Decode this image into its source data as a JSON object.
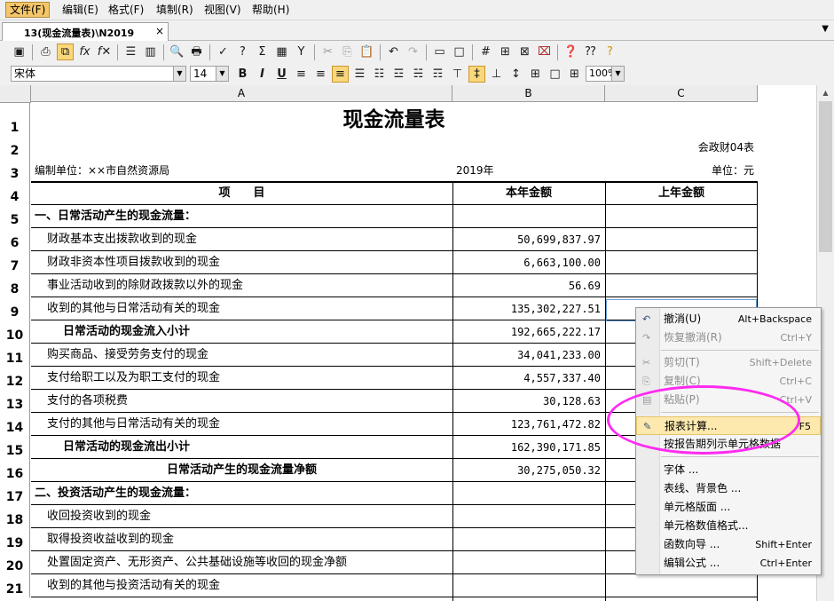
{
  "menubar": {
    "items": [
      "文件(F)",
      "编辑(E)",
      "格式(F)",
      "填制(R)",
      "视图(V)",
      "帮助(H)"
    ]
  },
  "tab": {
    "label": "13(现金流量表)\\N2019",
    "close": "×",
    "dropdown": "▼"
  },
  "format": {
    "font_name": "宋体",
    "font_size": "14",
    "zoom": "100%",
    "bold": "B",
    "italic": "I",
    "underline": "U"
  },
  "sheet": {
    "columns": [
      "A",
      "B",
      "C"
    ],
    "title": "现金流量表",
    "form_code": "会政财04表",
    "unit_label": "编制单位：××市自然资源局",
    "year": "2019年",
    "currency_unit": "单位：元",
    "header": {
      "item": "项　　目",
      "current": "本年金额",
      "previous": "上年金额"
    },
    "row_numbers": [
      "1",
      "2",
      "3",
      "4",
      "5",
      "6",
      "7",
      "8",
      "9",
      "10",
      "11",
      "12",
      "13",
      "14",
      "15",
      "16",
      "17",
      "18",
      "19",
      "20",
      "21"
    ],
    "rows": [
      {
        "label": "一、日常活动产生的现金流量：",
        "value": ""
      },
      {
        "label": "财政基本支出拨款收到的现金",
        "value": "50,699,837.97"
      },
      {
        "label": "财政非资本性项目拨款收到的现金",
        "value": "6,663,100.00"
      },
      {
        "label": "事业活动收到的除财政拨款以外的现金",
        "value": "56.69"
      },
      {
        "label": "收到的其他与日常活动有关的现金",
        "value": "135,302,227.51"
      },
      {
        "label": "日常活动的现金流入小计",
        "value": "192,665,222.17"
      },
      {
        "label": "购买商品、接受劳务支付的现金",
        "value": "34,041,233.00"
      },
      {
        "label": "支付给职工以及为职工支付的现金",
        "value": "4,557,337.40"
      },
      {
        "label": "支付的各项税费",
        "value": "30,128.63"
      },
      {
        "label": "支付的其他与日常活动有关的现金",
        "value": "123,761,472.82"
      },
      {
        "label": "日常活动的现金流出小计",
        "value": "162,390,171.85"
      },
      {
        "label": "日常活动产生的现金流量净额",
        "value": "30,275,050.32"
      },
      {
        "label": "二、投资活动产生的现金流量：",
        "value": ""
      },
      {
        "label": "收回投资收到的现金",
        "value": ""
      },
      {
        "label": "取得投资收益收到的现金",
        "value": ""
      },
      {
        "label": "处置固定资产、无形资产、公共基础设施等收回的现金净额",
        "value": ""
      },
      {
        "label": "收到的其他与投资活动有关的现金",
        "value": ""
      }
    ]
  },
  "context_menu": {
    "items": [
      {
        "label": "撤消(U)",
        "shortcut": "Alt+Backspace",
        "icon": "undo-icon"
      },
      {
        "label": "恢复撤消(R)",
        "shortcut": "Ctrl+Y",
        "icon": "redo-icon"
      },
      {
        "label": "剪切(T)",
        "shortcut": "Shift+Delete",
        "icon": "cut-icon"
      },
      {
        "label": "复制(C)",
        "shortcut": "Ctrl+C",
        "icon": "copy-icon"
      },
      {
        "label": "粘贴(P)",
        "shortcut": "Ctrl+V",
        "icon": "paste-icon"
      },
      {
        "label": "报表计算...",
        "shortcut": "F5",
        "icon": "calculate-icon"
      },
      {
        "label": "按报告期列示单元格数据",
        "shortcut": "",
        "icon": ""
      },
      {
        "label": "字体 ...",
        "shortcut": "",
        "icon": ""
      },
      {
        "label": "表线、背景色 ...",
        "shortcut": "",
        "icon": ""
      },
      {
        "label": "单元格版面 ...",
        "shortcut": "",
        "icon": ""
      },
      {
        "label": "单元格数值格式...",
        "shortcut": "",
        "icon": ""
      },
      {
        "label": "函数向导 ...",
        "shortcut": "Shift+Enter",
        "icon": ""
      },
      {
        "label": "编辑公式 ...",
        "shortcut": "Ctrl+Enter",
        "icon": ""
      }
    ]
  },
  "colors": {
    "highlight_ellipse": "#ff2bf0",
    "menu_hover": "#fde9ae",
    "active_menu": "#f5c66a"
  }
}
